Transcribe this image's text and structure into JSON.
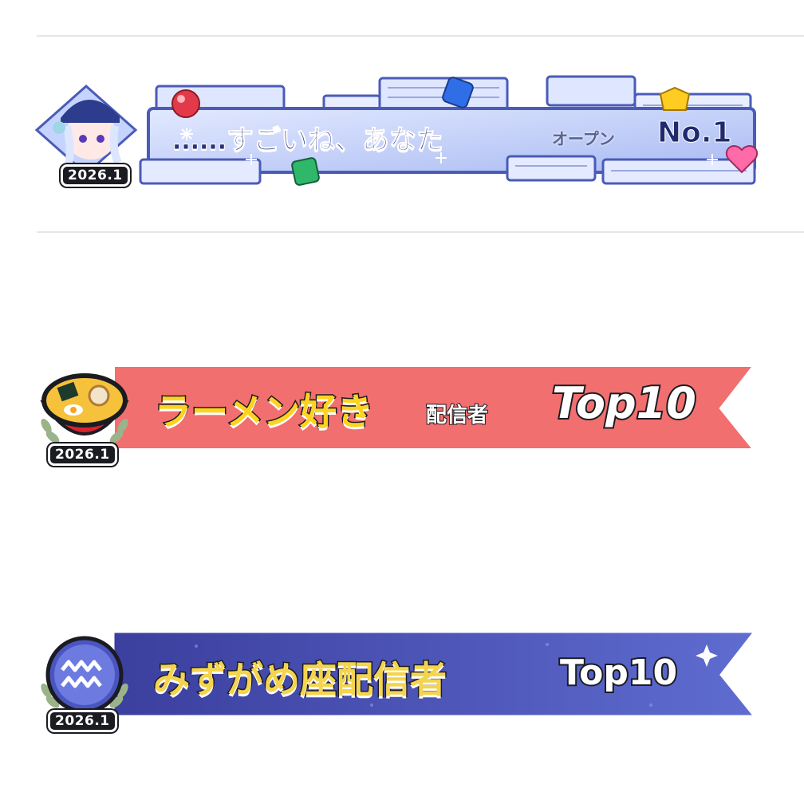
{
  "badges": [
    {
      "date": "2026.1",
      "title": "……すごいね、あなた",
      "sub": "オープン",
      "rank": "No.1",
      "icon": "girl-character-icon",
      "colors": {
        "bg": "#c9d6ff",
        "accent": "#4a5bb8",
        "text": "#2b2f78"
      }
    },
    {
      "date": "2026.1",
      "title": "ラーメン好き",
      "sub": "配信者",
      "rank": "Top10",
      "icon": "ramen-bowl-icon",
      "colors": {
        "ribbon": "#f26f6f",
        "title": "#ffd21f",
        "outline": "#1b1b22"
      }
    },
    {
      "date": "2026.1",
      "title": "みずがめ座配信者",
      "sub": "",
      "rank": "Top10",
      "icon": "aquarius-icon",
      "colors": {
        "ribbon": "#4f58b8",
        "title": "#f4d44e",
        "outline": "#1b1b22"
      }
    }
  ]
}
